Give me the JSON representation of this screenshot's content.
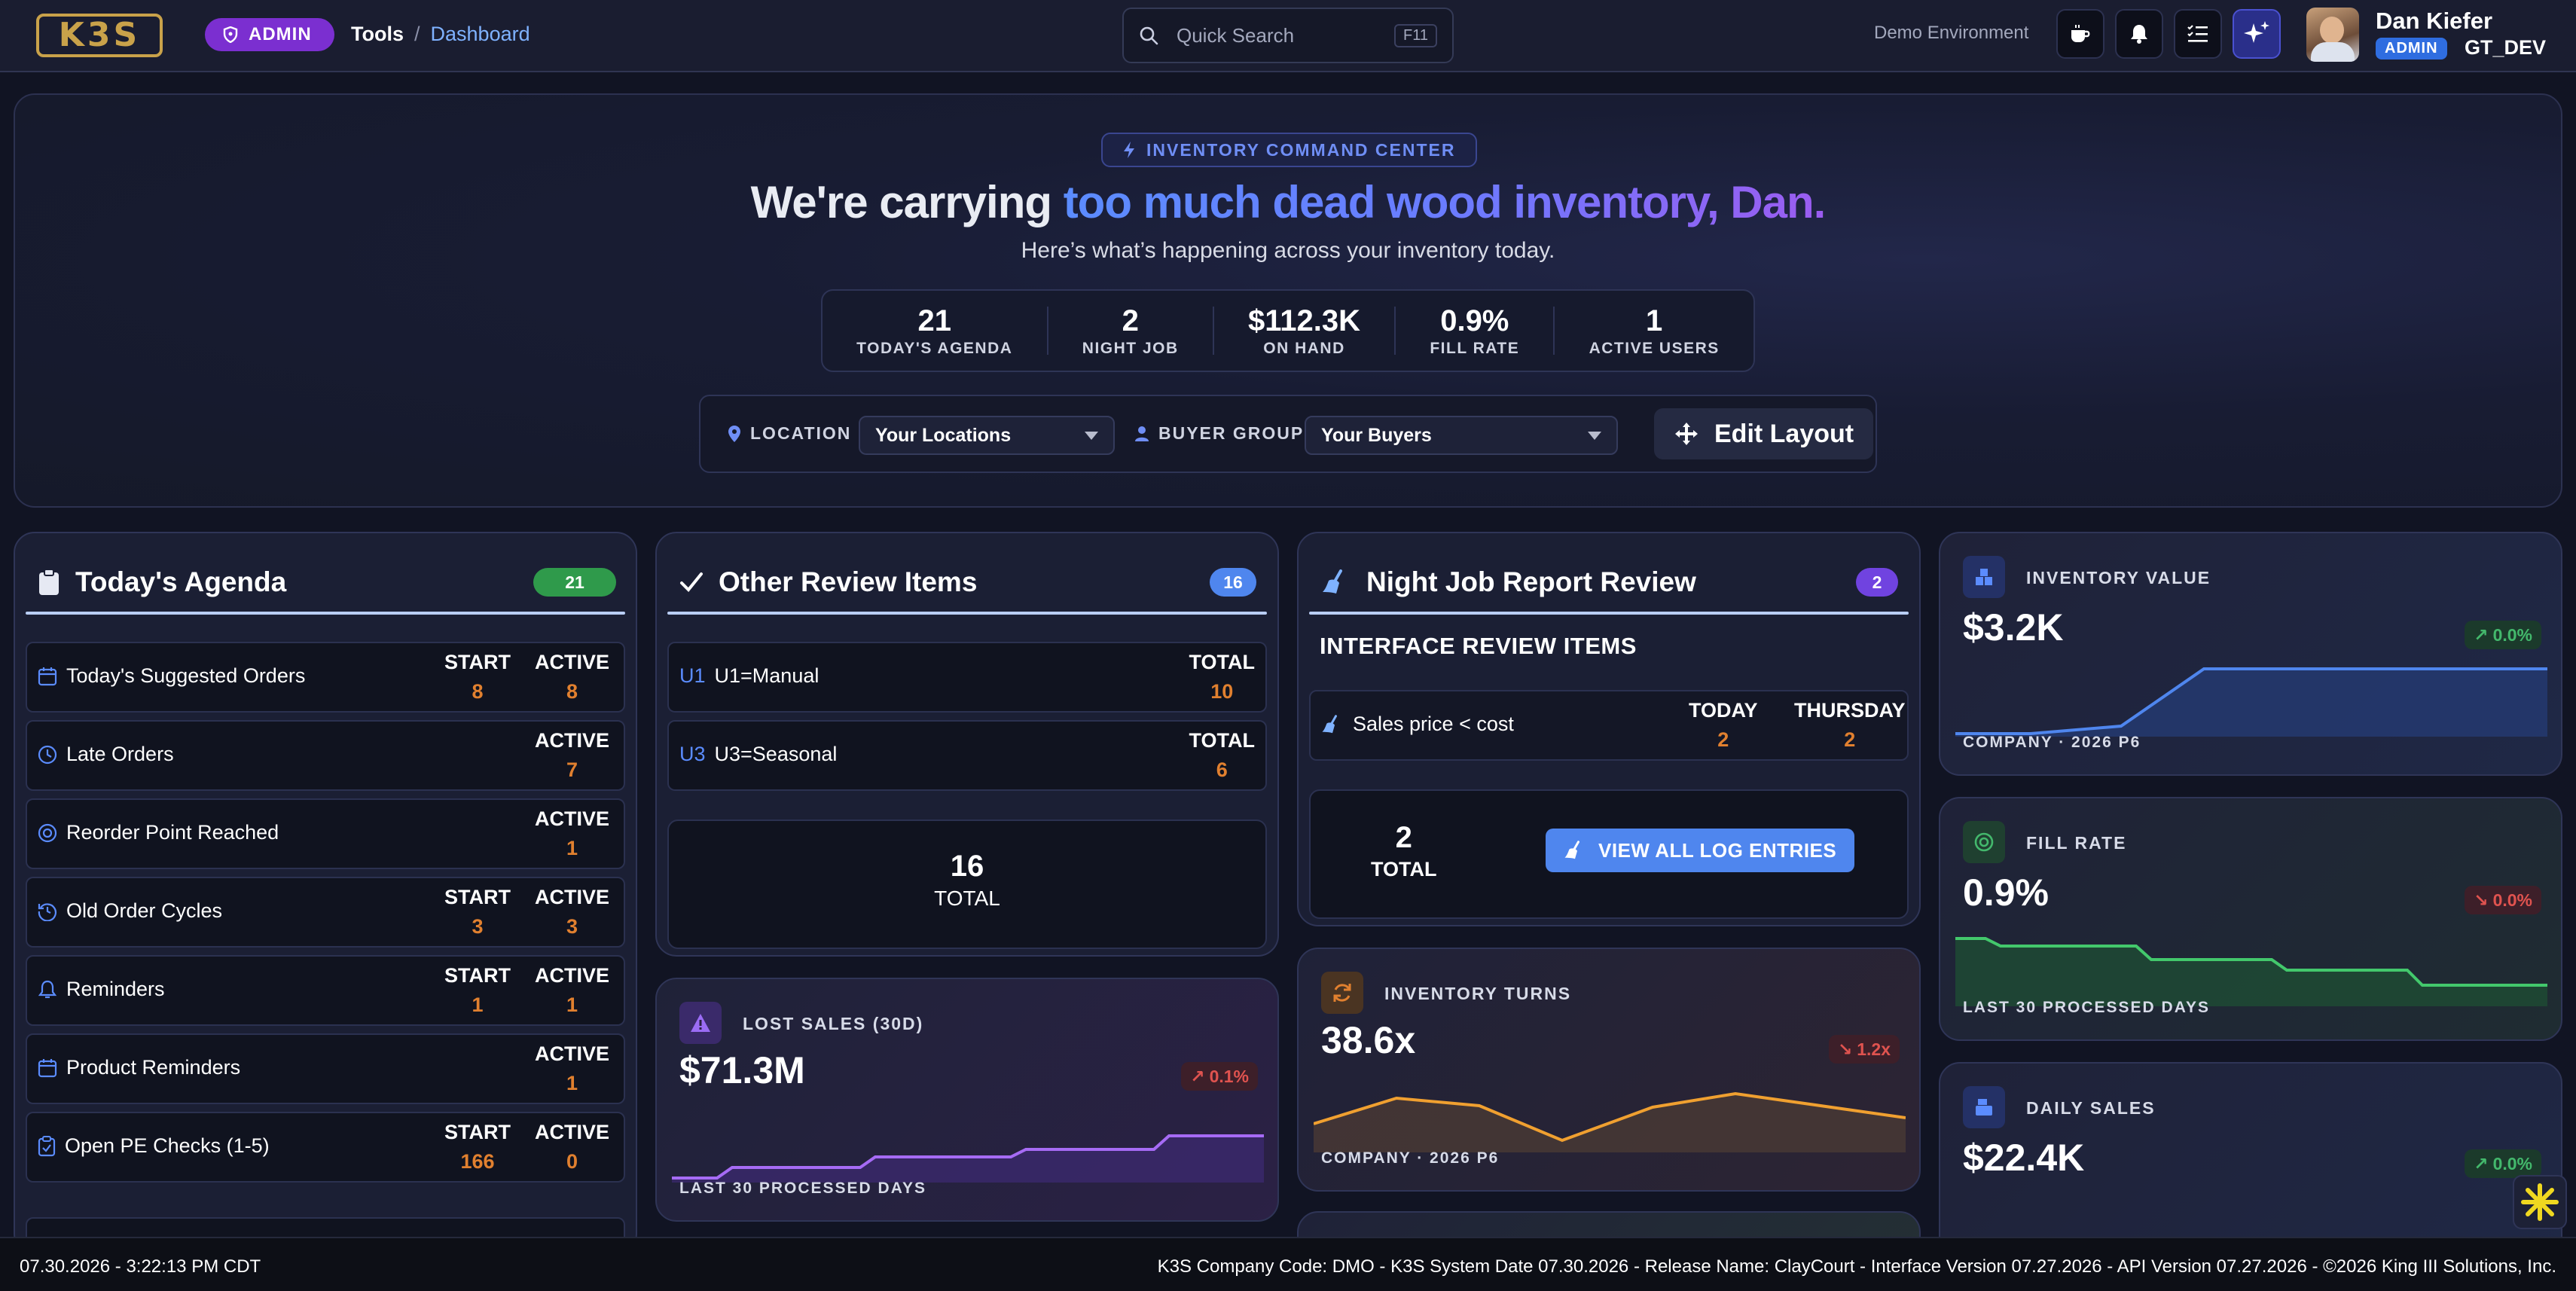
{
  "app": {
    "logo": "K3S",
    "role": "ADMIN"
  },
  "breadcrumb": {
    "tools": "Tools",
    "sep": "/",
    "current": "Dashboard"
  },
  "search": {
    "placeholder": "Quick Search",
    "shortcut": "F11"
  },
  "environment": "Demo Environment",
  "toolbar_icons": [
    "coffee-icon",
    "bell-icon",
    "checklist-icon",
    "sparkle-icon"
  ],
  "user": {
    "name": "Dan Kiefer",
    "badge": "ADMIN",
    "code": "GT_DEV"
  },
  "hero": {
    "tag": "INVENTORY COMMAND CENTER",
    "title_plain": "We're carrying ",
    "title_highlight": "too much dead wood inventory, Dan.",
    "subtitle": "Here’s what’s happening across your inventory today.",
    "stats": [
      {
        "value": "21",
        "label": "TODAY'S AGENDA"
      },
      {
        "value": "2",
        "label": "NIGHT JOB"
      },
      {
        "value": "$112.3K",
        "label": "ON HAND"
      },
      {
        "value": "0.9%",
        "label": "FILL RATE"
      },
      {
        "value": "1",
        "label": "ACTIVE USERS"
      }
    ],
    "filters": {
      "location_label": "LOCATION",
      "location_value": "Your Locations",
      "buyer_label": "BUYER GROUP",
      "buyer_value": "Your Buyers",
      "edit_layout": "Edit Layout"
    }
  },
  "agenda": {
    "title": "Today's Agenda",
    "count": "21",
    "rows": [
      {
        "label": "Today's Suggested Orders",
        "icon": "calendar-icon",
        "metrics": [
          {
            "label": "START",
            "value": "8"
          },
          {
            "label": "ACTIVE",
            "value": "8"
          }
        ]
      },
      {
        "label": "Late Orders",
        "icon": "clock-icon",
        "metrics": [
          {
            "label": "ACTIVE",
            "value": "7"
          }
        ]
      },
      {
        "label": "Reorder Point Reached",
        "icon": "target-icon",
        "metrics": [
          {
            "label": "ACTIVE",
            "value": "1"
          }
        ]
      },
      {
        "label": "Old Order Cycles",
        "icon": "history-icon",
        "metrics": [
          {
            "label": "START",
            "value": "3"
          },
          {
            "label": "ACTIVE",
            "value": "3"
          }
        ]
      },
      {
        "label": "Reminders",
        "icon": "bell-icon",
        "metrics": [
          {
            "label": "START",
            "value": "1"
          },
          {
            "label": "ACTIVE",
            "value": "1"
          }
        ]
      },
      {
        "label": "Product Reminders",
        "icon": "calendar-icon",
        "metrics": [
          {
            "label": "ACTIVE",
            "value": "1"
          }
        ]
      },
      {
        "label": "Open PE Checks (1-5)",
        "icon": "clipboard-check-icon",
        "metrics": [
          {
            "label": "START",
            "value": "166"
          },
          {
            "label": "ACTIVE",
            "value": "0"
          }
        ]
      }
    ]
  },
  "review": {
    "title": "Other Review Items",
    "count": "16",
    "rows": [
      {
        "code": "U1",
        "label": "U1=Manual",
        "metric_label": "TOTAL",
        "metric_value": "10"
      },
      {
        "code": "U3",
        "label": "U3=Seasonal",
        "metric_label": "TOTAL",
        "metric_value": "6"
      }
    ],
    "total_value": "16",
    "total_label": "TOTAL"
  },
  "nightjob": {
    "title": "Night Job Report Review",
    "count": "2",
    "subtitle": "INTERFACE REVIEW ITEMS",
    "row": {
      "label": "Sales price < cost",
      "today_label": "TODAY",
      "today_value": "2",
      "thu_label": "THURSDAY",
      "thu_value": "2"
    },
    "total_value": "2",
    "total_label": "TOTAL",
    "view_all": "VIEW ALL LOG ENTRIES"
  },
  "kpis": {
    "lost_sales": {
      "title": "LOST SALES (30D)",
      "value": "$71.3M",
      "change": "0.1%",
      "footer": "LAST 30 PROCESSED DAYS"
    },
    "inventory_turns": {
      "title": "INVENTORY TURNS",
      "value": "38.6x",
      "change": "1.2x",
      "footer": "COMPANY · 2026 P6"
    },
    "inventory_value": {
      "title": "INVENTORY VALUE",
      "value": "$3.2K",
      "change": "0.0%",
      "footer": "COMPANY · 2026 P6"
    },
    "fill_rate": {
      "title": "FILL RATE",
      "value": "0.9%",
      "change": "0.0%",
      "footer": "LAST 30 PROCESSED DAYS"
    },
    "daily_sales": {
      "title": "DAILY SALES",
      "value": "$22.4K",
      "change": "0.0%"
    }
  },
  "colors": {
    "accent": "#5b8cff",
    "purple": "#9b5cf0",
    "orange": "#e1802f",
    "green": "#43b86c",
    "red": "#e0534f"
  },
  "footer": {
    "left": "07.30.2026 - 3:22:13 PM CDT",
    "right": "K3S Company Code: DMO - K3S System Date 07.30.2026 - Release Name: ClayCourt - Interface Version 07.27.2026 - API Version 07.27.2026 - ©2026 King III Solutions, Inc."
  }
}
